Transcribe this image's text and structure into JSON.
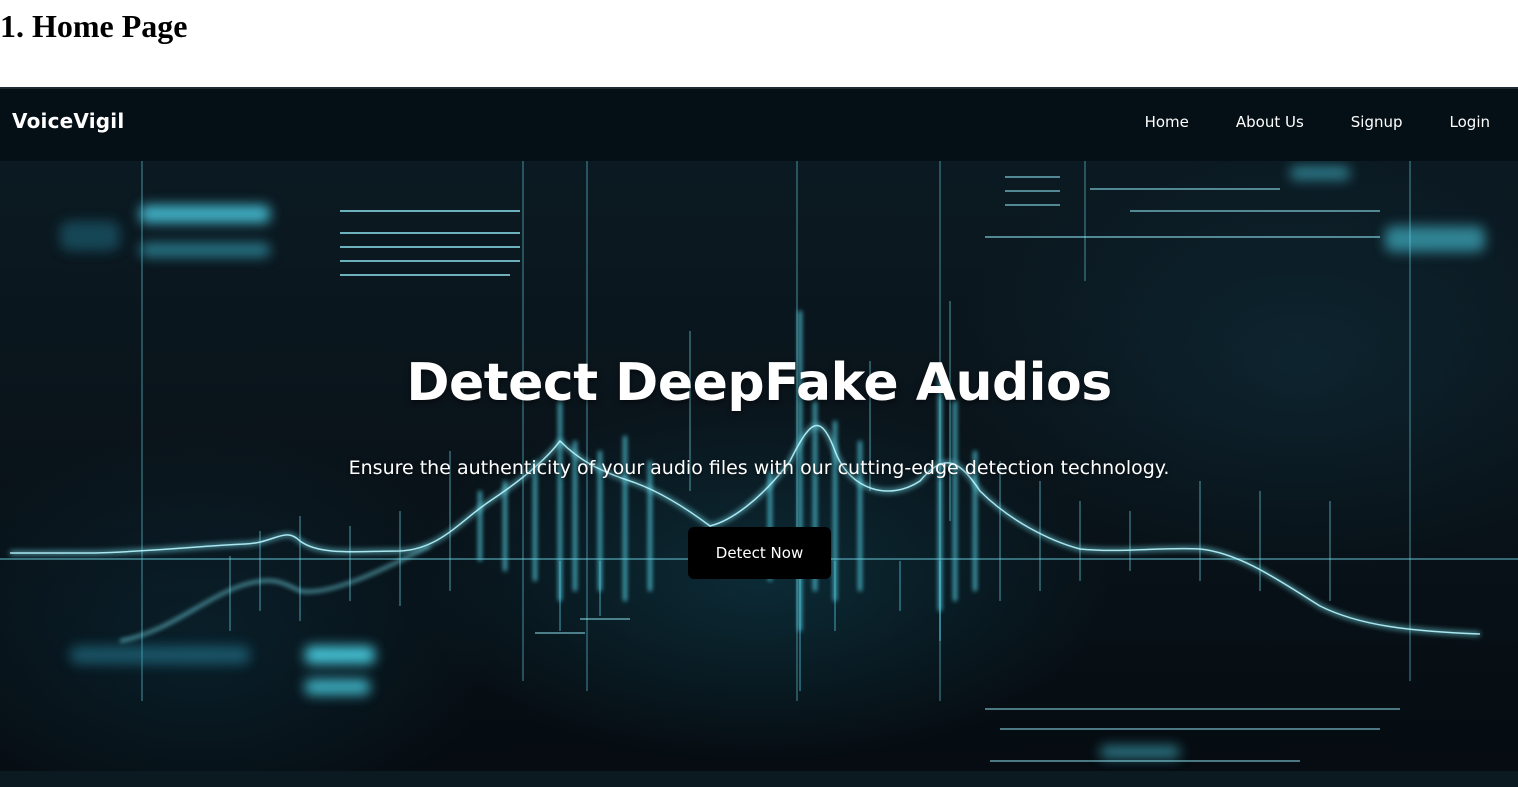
{
  "document": {
    "heading": "1. Home Page"
  },
  "navbar": {
    "brand": "VoiceVigil",
    "links": [
      {
        "label": "Home"
      },
      {
        "label": "About Us"
      },
      {
        "label": "Signup"
      },
      {
        "label": "Login"
      }
    ]
  },
  "hero": {
    "title": "Detect DeepFake Audios",
    "subtitle": "Ensure the authenticity of your audio files with our cutting-edge detection technology.",
    "cta_label": "Detect Now",
    "background_image": "audio-waveform-graphic",
    "accent_color": "#3fd3e8"
  },
  "colors": {
    "navbar_bg": "#040f16",
    "hero_bg": "#0a141b",
    "button_bg": "#000000",
    "text": "#ffffff"
  }
}
